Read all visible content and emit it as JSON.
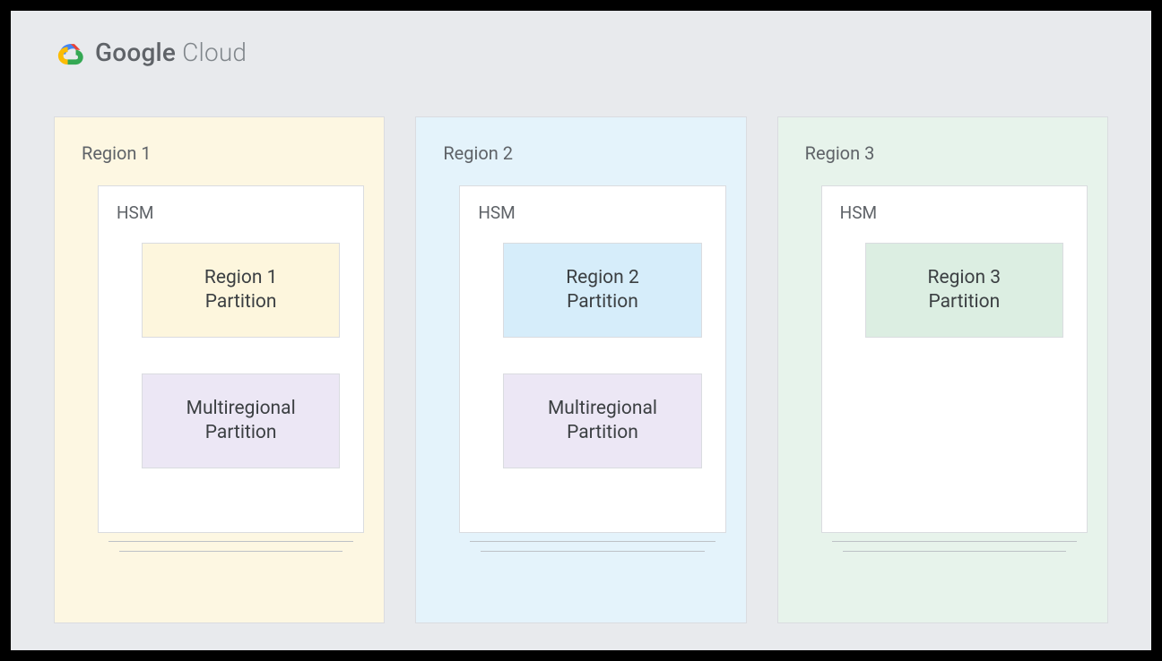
{
  "brand": {
    "name_bold": "Google",
    "name_light": " Cloud"
  },
  "regions": [
    {
      "title": "Region 1",
      "hsm_label": "HSM",
      "partitions": [
        {
          "label": "Region 1\nPartition",
          "color": "p-yellow"
        },
        {
          "label": "Multiregional\nPartition",
          "color": "p-purple"
        }
      ],
      "class": "region-1"
    },
    {
      "title": "Region 2",
      "hsm_label": "HSM",
      "partitions": [
        {
          "label": "Region 2\nPartition",
          "color": "p-blue"
        },
        {
          "label": "Multiregional\nPartition",
          "color": "p-purple"
        }
      ],
      "class": "region-2"
    },
    {
      "title": "Region 3",
      "hsm_label": "HSM",
      "partitions": [
        {
          "label": "Region 3\nPartition",
          "color": "p-green"
        }
      ],
      "class": "region-3"
    }
  ]
}
